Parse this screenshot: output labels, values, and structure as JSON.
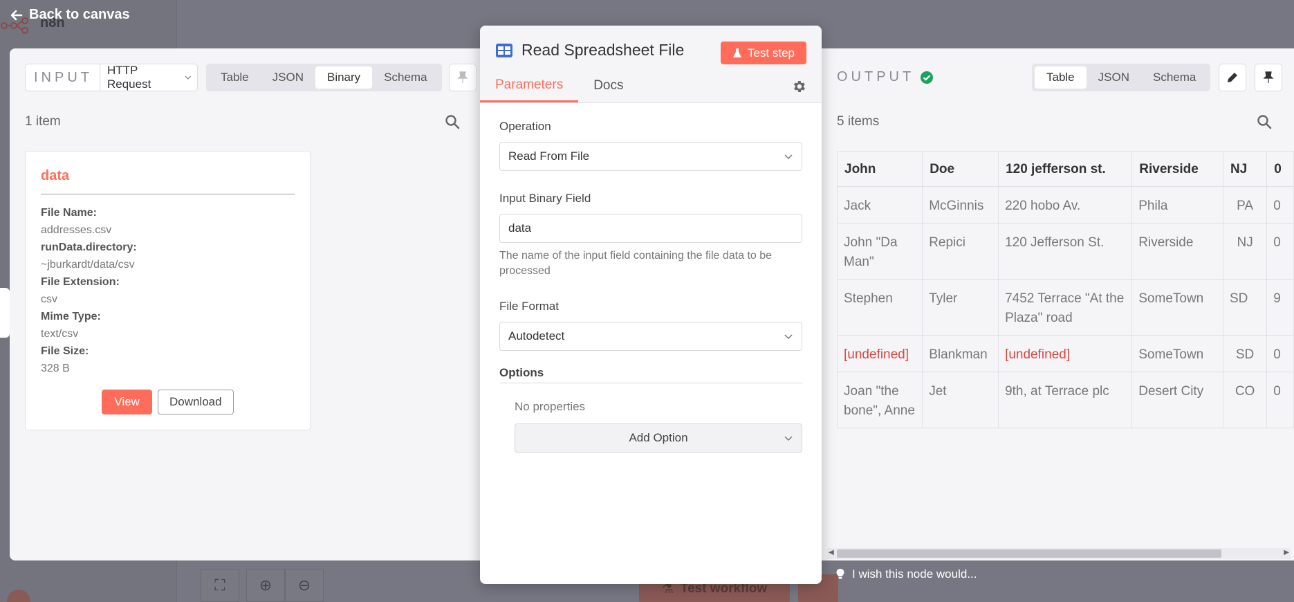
{
  "background": {
    "app_name": "n8n",
    "test_workflow_label": "Test workflow"
  },
  "back_link": "Back to canvas",
  "input": {
    "label": "INPUT",
    "source_select": "HTTP Request",
    "view_tabs": [
      "Table",
      "JSON",
      "Binary",
      "Schema"
    ],
    "active_tab": "Binary",
    "items_count": "1 item",
    "binary": {
      "title": "data",
      "fields": [
        {
          "key": "File Name:",
          "value": "addresses.csv"
        },
        {
          "key": "runData.directory:",
          "value": "~jburkardt/data/csv"
        },
        {
          "key": "File Extension:",
          "value": "csv"
        },
        {
          "key": "Mime Type:",
          "value": "text/csv"
        },
        {
          "key": "File Size:",
          "value": "328 B"
        }
      ],
      "view_label": "View",
      "download_label": "Download"
    }
  },
  "node": {
    "title": "Read Spreadsheet File",
    "test_step_label": "Test step",
    "tabs": [
      "Parameters",
      "Docs"
    ],
    "active_tab": "Parameters",
    "operation_label": "Operation",
    "operation_value": "Read From File",
    "binary_field_label": "Input Binary Field",
    "binary_field_value": "data",
    "binary_field_hint": "The name of the input field containing the file data to be processed",
    "file_format_label": "File Format",
    "file_format_value": "Autodetect",
    "options_label": "Options",
    "no_properties": "No properties",
    "add_option_label": "Add Option"
  },
  "output": {
    "label": "OUTPUT",
    "view_tabs": [
      "Table",
      "JSON",
      "Schema"
    ],
    "active_tab": "Table",
    "items_count": "5 items",
    "columns": [
      "John",
      "Doe",
      "120 jefferson st.",
      "Riverside",
      "NJ",
      "0"
    ],
    "rows": [
      [
        "Jack",
        "McGinnis",
        "220 hobo Av.",
        "Phila",
        "PA",
        "0"
      ],
      [
        "John \"Da Man\"",
        "Repici",
        "120 Jefferson St.",
        "Riverside",
        "NJ",
        "0"
      ],
      [
        "Stephen",
        "Tyler",
        "7452 Terrace \"At the Plaza\" road",
        "SomeTown",
        "SD",
        "9"
      ],
      [
        "[undefined]",
        "Blankman",
        "[undefined]",
        "SomeTown",
        "SD",
        "0"
      ],
      [
        "Joan \"the bone\", Anne",
        "Jet",
        "9th, at Terrace plc",
        "Desert City",
        "CO",
        "0"
      ]
    ]
  },
  "feedback_text": "I wish this node would...",
  "colors": {
    "accent": "#ff6d5a",
    "success": "#1aa260",
    "undefined_text": "#e0443e",
    "node_icon": "#3f6bd6"
  }
}
